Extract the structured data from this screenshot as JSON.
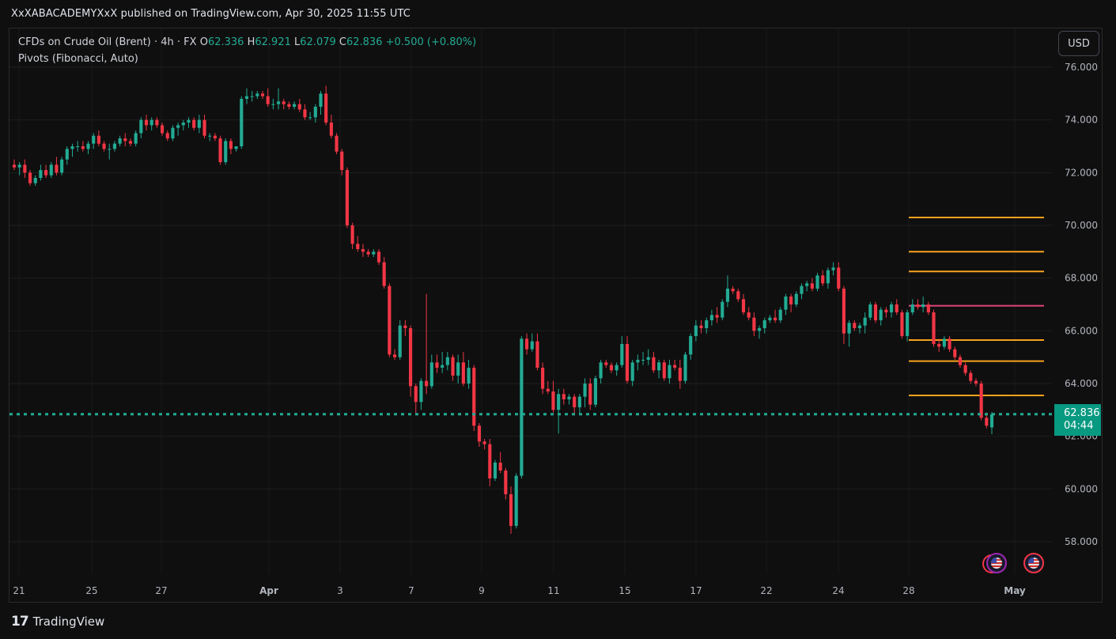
{
  "header": {
    "publish_line": "XxXABACADEMYXxX published on TradingView.com, Apr 30, 2025 11:55 UTC"
  },
  "legend": {
    "symbol": "CFDs on Crude Oil (Brent) · 4h · FX",
    "open_label": "O",
    "open": "62.336",
    "high_label": "H",
    "high": "62.921",
    "low_label": "L",
    "low": "62.079",
    "close_label": "C",
    "close": "62.836",
    "change": "+0.500 (+0.80%)",
    "indicator": "Pivots (Fibonacci, Auto)"
  },
  "currency_button": "USD",
  "price_tag": {
    "price": "62.836",
    "countdown": "04:44"
  },
  "brand": {
    "name": "TradingView",
    "logo_icon": "tradingview-logo-icon"
  },
  "flags": [
    "us-flag-icon",
    "us-flag-icon"
  ],
  "colors": {
    "up": "#22ab94",
    "down": "#f23645",
    "pivot_orange": "#f7a21b",
    "pivot_pink": "#e0457b",
    "background": "#0f0f0f"
  },
  "chart_data": {
    "type": "candlestick",
    "symbol": "CFDs on Crude Oil (Brent)",
    "timeframe": "4h",
    "ylim": [
      57,
      76.3
    ],
    "y_ticks": [
      "76.000",
      "74.000",
      "72.000",
      "70.000",
      "68.000",
      "66.000",
      "64.000",
      "62.000",
      "60.000",
      "58.000"
    ],
    "x_ticks": [
      "21",
      "25",
      "27",
      "Apr",
      "3",
      "7",
      "9",
      "11",
      "15",
      "17",
      "22",
      "24",
      "28",
      "May"
    ],
    "current_price": 62.836,
    "pivot_levels": [
      70.3,
      69.0,
      68.25,
      66.95,
      65.65,
      64.85,
      63.55
    ],
    "candles": [
      [
        72.3,
        72.5,
        72.1,
        72.2
      ],
      [
        72.2,
        72.4,
        71.9,
        72.3
      ],
      [
        72.3,
        72.5,
        71.8,
        72.0
      ],
      [
        72.0,
        72.1,
        71.5,
        71.6
      ],
      [
        71.6,
        71.9,
        71.5,
        71.8
      ],
      [
        71.8,
        72.3,
        71.7,
        72.1
      ],
      [
        72.1,
        72.3,
        71.8,
        71.9
      ],
      [
        71.9,
        72.4,
        71.8,
        72.3
      ],
      [
        72.3,
        72.6,
        71.9,
        72.0
      ],
      [
        72.0,
        72.6,
        71.9,
        72.5
      ],
      [
        72.5,
        73.0,
        72.3,
        72.9
      ],
      [
        72.9,
        73.1,
        72.6,
        73.0
      ],
      [
        73.0,
        73.2,
        72.8,
        73.0
      ],
      [
        73.0,
        73.2,
        72.8,
        72.9
      ],
      [
        72.9,
        73.2,
        72.7,
        73.1
      ],
      [
        73.1,
        73.5,
        72.9,
        73.4
      ],
      [
        73.4,
        73.6,
        73.0,
        73.1
      ],
      [
        73.1,
        73.2,
        72.8,
        72.9
      ],
      [
        72.9,
        73.1,
        72.5,
        72.9
      ],
      [
        72.9,
        73.2,
        72.8,
        73.1
      ],
      [
        73.1,
        73.4,
        73.0,
        73.3
      ],
      [
        73.3,
        73.5,
        73.0,
        73.2
      ],
      [
        73.2,
        73.3,
        73.0,
        73.1
      ],
      [
        73.1,
        73.6,
        73.0,
        73.5
      ],
      [
        73.5,
        74.1,
        73.3,
        74.0
      ],
      [
        74.0,
        74.2,
        73.6,
        73.8
      ],
      [
        73.8,
        74.1,
        73.6,
        74.0
      ],
      [
        74.0,
        74.1,
        73.7,
        73.8
      ],
      [
        73.8,
        73.9,
        73.4,
        73.5
      ],
      [
        73.5,
        73.6,
        73.2,
        73.3
      ],
      [
        73.3,
        73.8,
        73.2,
        73.7
      ],
      [
        73.7,
        73.9,
        73.4,
        73.8
      ],
      [
        73.8,
        74.0,
        73.6,
        73.9
      ],
      [
        73.9,
        74.1,
        73.7,
        74.0
      ],
      [
        74.0,
        74.1,
        73.6,
        73.7
      ],
      [
        73.7,
        74.2,
        73.5,
        74.0
      ],
      [
        74.0,
        74.2,
        73.3,
        73.4
      ],
      [
        73.4,
        73.5,
        73.2,
        73.4
      ],
      [
        73.4,
        73.5,
        73.2,
        73.3
      ],
      [
        73.3,
        73.4,
        72.3,
        72.4
      ],
      [
        72.4,
        73.3,
        72.3,
        73.2
      ],
      [
        73.2,
        73.3,
        72.7,
        72.9
      ],
      [
        72.9,
        73.0,
        72.8,
        73.0
      ],
      [
        73.0,
        74.9,
        72.9,
        74.8
      ],
      [
        74.8,
        75.2,
        74.6,
        74.9
      ],
      [
        74.9,
        75.1,
        74.7,
        74.9
      ],
      [
        74.9,
        75.1,
        74.8,
        75.0
      ],
      [
        75.0,
        75.1,
        74.8,
        74.9
      ],
      [
        74.9,
        75.2,
        74.5,
        74.6
      ],
      [
        74.6,
        74.8,
        74.4,
        74.6
      ],
      [
        74.6,
        75.2,
        74.4,
        74.7
      ],
      [
        74.7,
        74.8,
        74.4,
        74.6
      ],
      [
        74.6,
        74.7,
        74.4,
        74.5
      ],
      [
        74.5,
        74.7,
        74.4,
        74.6
      ],
      [
        74.6,
        74.8,
        74.3,
        74.4
      ],
      [
        74.4,
        74.6,
        74.0,
        74.1
      ],
      [
        74.1,
        74.3,
        74.0,
        74.1
      ],
      [
        74.1,
        74.6,
        73.9,
        74.5
      ],
      [
        74.5,
        75.1,
        74.2,
        75.0
      ],
      [
        75.0,
        75.3,
        73.8,
        73.9
      ],
      [
        73.9,
        74.2,
        73.3,
        73.4
      ],
      [
        73.4,
        73.5,
        72.7,
        72.8
      ],
      [
        72.8,
        72.9,
        71.9,
        72.1
      ],
      [
        72.1,
        72.2,
        69.9,
        70.0
      ],
      [
        70.0,
        70.1,
        69.1,
        69.3
      ],
      [
        69.3,
        69.6,
        69.0,
        69.1
      ],
      [
        69.1,
        69.3,
        68.8,
        69.0
      ],
      [
        69.0,
        69.1,
        68.8,
        68.9
      ],
      [
        68.9,
        69.1,
        68.8,
        69.0
      ],
      [
        69.0,
        69.1,
        68.5,
        68.6
      ],
      [
        68.6,
        68.8,
        67.6,
        67.7
      ],
      [
        67.7,
        67.8,
        65.0,
        65.1
      ],
      [
        65.1,
        65.3,
        64.9,
        65.0
      ],
      [
        65.0,
        66.4,
        64.9,
        66.2
      ],
      [
        66.2,
        66.4,
        65.8,
        66.1
      ],
      [
        66.1,
        66.2,
        63.5,
        63.9
      ],
      [
        63.9,
        64.0,
        62.8,
        63.3
      ],
      [
        63.3,
        64.2,
        63.0,
        64.1
      ],
      [
        64.1,
        67.4,
        63.6,
        63.9
      ],
      [
        63.9,
        65.1,
        63.8,
        64.8
      ],
      [
        64.8,
        65.1,
        64.4,
        64.6
      ],
      [
        64.6,
        65.2,
        64.4,
        64.7
      ],
      [
        64.7,
        65.2,
        64.5,
        65.0
      ],
      [
        65.0,
        65.1,
        64.1,
        64.3
      ],
      [
        64.3,
        65.1,
        64.0,
        64.8
      ],
      [
        64.8,
        65.2,
        63.9,
        64.0
      ],
      [
        64.0,
        64.9,
        63.8,
        64.6
      ],
      [
        64.6,
        64.7,
        62.2,
        62.4
      ],
      [
        62.4,
        62.5,
        61.6,
        61.8
      ],
      [
        61.8,
        61.9,
        61.5,
        61.7
      ],
      [
        61.7,
        61.9,
        60.1,
        60.4
      ],
      [
        60.4,
        61.1,
        60.3,
        61.0
      ],
      [
        61.0,
        61.4,
        60.6,
        60.7
      ],
      [
        60.7,
        60.8,
        59.6,
        59.8
      ],
      [
        59.8,
        60.1,
        58.3,
        58.6
      ],
      [
        58.6,
        60.6,
        58.5,
        60.5
      ],
      [
        60.5,
        65.8,
        60.4,
        65.7
      ],
      [
        65.7,
        65.9,
        65.1,
        65.3
      ],
      [
        65.3,
        65.9,
        65.2,
        65.6
      ],
      [
        65.6,
        65.9,
        64.5,
        64.6
      ],
      [
        64.6,
        64.8,
        63.6,
        63.8
      ],
      [
        63.8,
        64.1,
        63.6,
        63.7
      ],
      [
        63.7,
        64.1,
        62.9,
        63.0
      ],
      [
        63.0,
        63.8,
        62.1,
        63.6
      ],
      [
        63.6,
        63.8,
        63.2,
        63.4
      ],
      [
        63.4,
        63.6,
        63.2,
        63.5
      ],
      [
        63.5,
        63.6,
        62.8,
        63.1
      ],
      [
        63.1,
        63.6,
        62.8,
        63.5
      ],
      [
        63.5,
        64.2,
        63.1,
        64.0
      ],
      [
        64.0,
        64.2,
        63.0,
        63.2
      ],
      [
        63.2,
        64.3,
        63.1,
        64.2
      ],
      [
        64.2,
        64.9,
        64.0,
        64.8
      ],
      [
        64.8,
        64.9,
        64.6,
        64.7
      ],
      [
        64.7,
        64.8,
        64.4,
        64.5
      ],
      [
        64.5,
        64.8,
        64.3,
        64.7
      ],
      [
        64.7,
        65.8,
        64.6,
        65.5
      ],
      [
        65.5,
        65.8,
        64.0,
        64.1
      ],
      [
        64.1,
        64.9,
        63.9,
        64.8
      ],
      [
        64.8,
        65.1,
        64.5,
        64.9
      ],
      [
        64.9,
        65.2,
        64.7,
        64.9
      ],
      [
        64.9,
        65.3,
        64.7,
        65.0
      ],
      [
        65.0,
        65.2,
        64.4,
        64.5
      ],
      [
        64.5,
        64.9,
        64.2,
        64.8
      ],
      [
        64.8,
        64.9,
        64.1,
        64.2
      ],
      [
        64.2,
        64.9,
        64.0,
        64.7
      ],
      [
        64.7,
        64.9,
        64.5,
        64.6
      ],
      [
        64.6,
        64.9,
        63.8,
        64.1
      ],
      [
        64.1,
        65.2,
        64.0,
        65.1
      ],
      [
        65.1,
        65.9,
        64.9,
        65.8
      ],
      [
        65.8,
        66.4,
        65.6,
        66.2
      ],
      [
        66.2,
        66.4,
        65.9,
        66.1
      ],
      [
        66.1,
        66.5,
        65.9,
        66.4
      ],
      [
        66.4,
        66.8,
        66.2,
        66.6
      ],
      [
        66.6,
        66.9,
        66.3,
        66.5
      ],
      [
        66.5,
        67.2,
        66.4,
        67.1
      ],
      [
        67.1,
        68.1,
        66.9,
        67.6
      ],
      [
        67.6,
        67.7,
        67.4,
        67.5
      ],
      [
        67.5,
        67.6,
        67.1,
        67.2
      ],
      [
        67.2,
        67.4,
        66.6,
        66.7
      ],
      [
        66.7,
        66.9,
        66.4,
        66.5
      ],
      [
        66.5,
        66.7,
        65.8,
        66.0
      ],
      [
        66.0,
        66.2,
        65.7,
        66.1
      ],
      [
        66.1,
        66.5,
        65.9,
        66.4
      ],
      [
        66.4,
        66.6,
        66.3,
        66.5
      ],
      [
        66.5,
        66.8,
        66.3,
        66.4
      ],
      [
        66.4,
        66.9,
        66.3,
        66.8
      ],
      [
        66.8,
        67.4,
        66.6,
        67.3
      ],
      [
        67.3,
        67.4,
        66.7,
        67.0
      ],
      [
        67.0,
        67.5,
        66.9,
        67.4
      ],
      [
        67.4,
        67.8,
        67.2,
        67.7
      ],
      [
        67.7,
        67.9,
        67.5,
        67.8
      ],
      [
        67.8,
        68.0,
        67.5,
        67.6
      ],
      [
        67.6,
        68.2,
        67.5,
        68.1
      ],
      [
        68.1,
        68.3,
        67.7,
        67.8
      ],
      [
        67.8,
        68.4,
        67.6,
        68.3
      ],
      [
        68.3,
        68.6,
        68.1,
        68.4
      ],
      [
        68.4,
        68.6,
        67.5,
        67.6
      ],
      [
        67.6,
        67.7,
        65.5,
        65.9
      ],
      [
        65.9,
        66.4,
        65.4,
        66.3
      ],
      [
        66.3,
        66.4,
        66.0,
        66.1
      ],
      [
        66.1,
        66.3,
        65.9,
        66.2
      ],
      [
        66.2,
        66.7,
        65.9,
        66.5
      ],
      [
        66.5,
        67.1,
        66.4,
        67.0
      ],
      [
        67.0,
        67.1,
        66.3,
        66.4
      ],
      [
        66.4,
        66.9,
        66.2,
        66.8
      ],
      [
        66.8,
        66.9,
        66.5,
        66.7
      ],
      [
        66.7,
        67.1,
        66.5,
        67.0
      ],
      [
        67.0,
        67.2,
        66.6,
        66.7
      ],
      [
        66.7,
        66.8,
        65.7,
        65.8
      ],
      [
        65.8,
        66.8,
        65.6,
        66.7
      ],
      [
        66.7,
        67.2,
        66.6,
        67.0
      ],
      [
        67.0,
        67.2,
        66.8,
        66.9
      ],
      [
        66.9,
        67.3,
        66.7,
        67.0
      ],
      [
        67.0,
        67.1,
        66.6,
        66.7
      ],
      [
        66.7,
        66.8,
        65.4,
        65.5
      ],
      [
        65.5,
        65.7,
        65.2,
        65.4
      ],
      [
        65.4,
        65.8,
        65.3,
        65.7
      ],
      [
        65.7,
        65.8,
        65.2,
        65.3
      ],
      [
        65.3,
        65.4,
        64.9,
        65.0
      ],
      [
        65.0,
        65.1,
        64.6,
        64.7
      ],
      [
        64.7,
        64.8,
        64.3,
        64.4
      ],
      [
        64.4,
        64.5,
        64.0,
        64.1
      ],
      [
        64.1,
        64.2,
        63.9,
        64.0
      ],
      [
        64.0,
        64.1,
        62.6,
        62.7
      ],
      [
        62.7,
        62.9,
        62.3,
        62.4
      ],
      [
        62.336,
        62.921,
        62.079,
        62.836
      ]
    ]
  }
}
